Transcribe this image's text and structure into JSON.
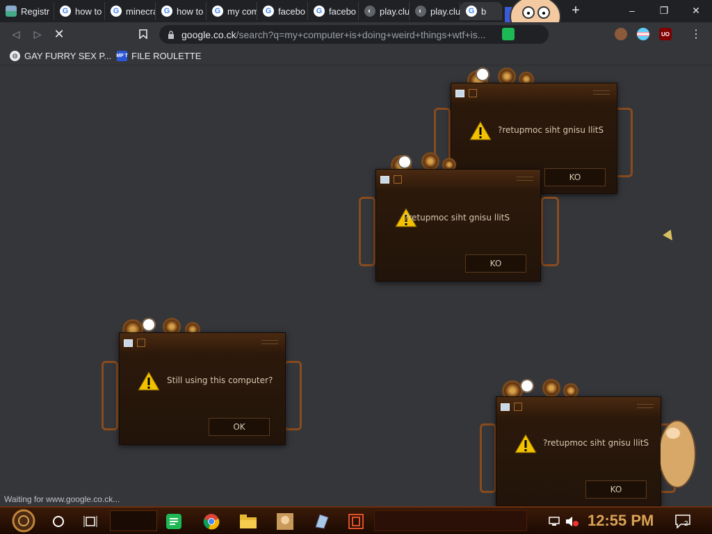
{
  "browser": {
    "tabs": [
      {
        "label": "Registr",
        "icon": "register-favicon"
      },
      {
        "label": "how to",
        "icon": "google-icon"
      },
      {
        "label": "minecra",
        "icon": "google-icon"
      },
      {
        "label": "how to",
        "icon": "google-icon"
      },
      {
        "label": "my com",
        "icon": "google-icon"
      },
      {
        "label": "facebo",
        "icon": "google-icon"
      },
      {
        "label": "facebo",
        "icon": "google-icon"
      },
      {
        "label": "play.clu",
        "icon": "globe-icon"
      },
      {
        "label": "play.clu",
        "icon": "globe-icon"
      },
      {
        "label": "b",
        "icon": "google-icon"
      }
    ],
    "new_tab_label": "+",
    "window_controls": {
      "minimize": "–",
      "restore": "❐",
      "close": "✕"
    },
    "url_host": "google.co.ck",
    "url_path": "/search?q=my+computer+is+doing+weird+things+wtf+is...",
    "status_text": "Waiting for www.google.co.ck...",
    "extensions": [
      {
        "name": "avatar-icon",
        "label": ""
      },
      {
        "name": "trans-flag-icon",
        "label": ""
      },
      {
        "name": "ublock-icon",
        "label": "UO"
      }
    ]
  },
  "bookmarks": [
    {
      "label": "GAY FURRY SEX P...",
      "icon": "globe-icon"
    },
    {
      "label": "FILE ROULETTE",
      "icon": "mp-icon",
      "icon_text": "MP T"
    }
  ],
  "dialogs": [
    {
      "message": "?retupmoc siht gnisu llitS",
      "button": "KO"
    },
    {
      "message": "?retupmoc siht gnisu llitS",
      "button": "KO"
    },
    {
      "message": "Still using this computer?",
      "button": "OK"
    },
    {
      "message": "?retupmoc siht gnisu llitS",
      "button": "KO"
    }
  ],
  "taskbar": {
    "clock": "12:55 PM",
    "notification_count": "2"
  },
  "colors": {
    "dialog_bg": "#241409",
    "dialog_text": "#d8c9b0",
    "page_bg": "#35363a",
    "clock": "#d9a256"
  }
}
